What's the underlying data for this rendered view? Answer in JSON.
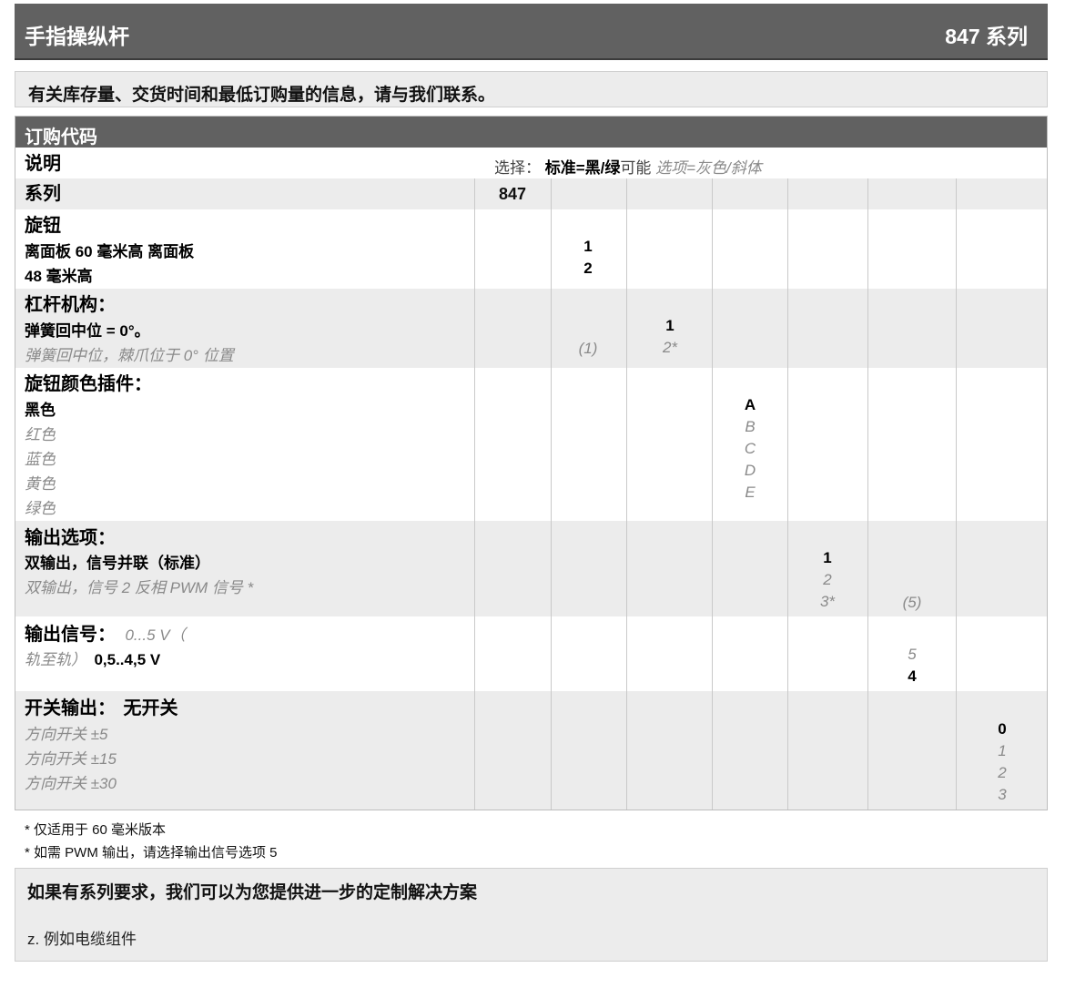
{
  "header": {
    "title": "手指操纵杆",
    "series": "847 系列"
  },
  "notice": "有关库存量、交货时间和最低订购量的信息，请与我们联系。",
  "table": {
    "title": "订购代码",
    "legend": {
      "label": "说明",
      "prefix": "选择：",
      "standard": "标准=黑/绿",
      "possible": "可能",
      "options": "选项=灰色/斜体"
    },
    "series": {
      "label": "系列",
      "code": "847"
    },
    "knob": {
      "heading": "旋钮",
      "line1": "离面板 60 毫米高 离面板",
      "line2": "48 毫米高",
      "codes": [
        "1",
        "2"
      ]
    },
    "lever": {
      "heading": "杠杆机构：",
      "standard": "弹簧回中位 = 0°。",
      "option": "弹簧回中位，棘爪位于 0° 位置",
      "code_paren": "(1)",
      "codes": [
        "1",
        "2*"
      ]
    },
    "color": {
      "heading": "旋钮颜色插件：",
      "items": [
        "黑色",
        "红色",
        "蓝色",
        "黄色",
        "绿色"
      ],
      "codes": [
        "A",
        "B",
        "C",
        "D",
        "E"
      ]
    },
    "output": {
      "heading": "输出选项：",
      "standard": "双输出，信号并联（标准）",
      "option": "双输出，信号 2 反相 PWM 信号 *",
      "codes": [
        "1",
        "2",
        "3*"
      ],
      "code_paren": "(5)"
    },
    "signal": {
      "heading": "输出信号：",
      "option_a": "0...5 V（",
      "option_b": "轨至轨）",
      "standard": "0,5..4,5 V",
      "codes": [
        "5",
        "4"
      ]
    },
    "switch": {
      "heading": "开关输出：",
      "standard": "无开关",
      "options": [
        "方向开关 ±5",
        "方向开关 ±15",
        "方向开关 ±30"
      ],
      "codes": [
        "0",
        "1",
        "2",
        "3"
      ]
    }
  },
  "footnotes": [
    "* 仅适用于 60 毫米版本",
    "* 如需 PWM 输出，请选择输出信号选项 5"
  ],
  "custom": {
    "title": "如果有系列要求，我们可以为您提供进一步的定制解决方案",
    "example": "z. 例如电缆组件"
  }
}
